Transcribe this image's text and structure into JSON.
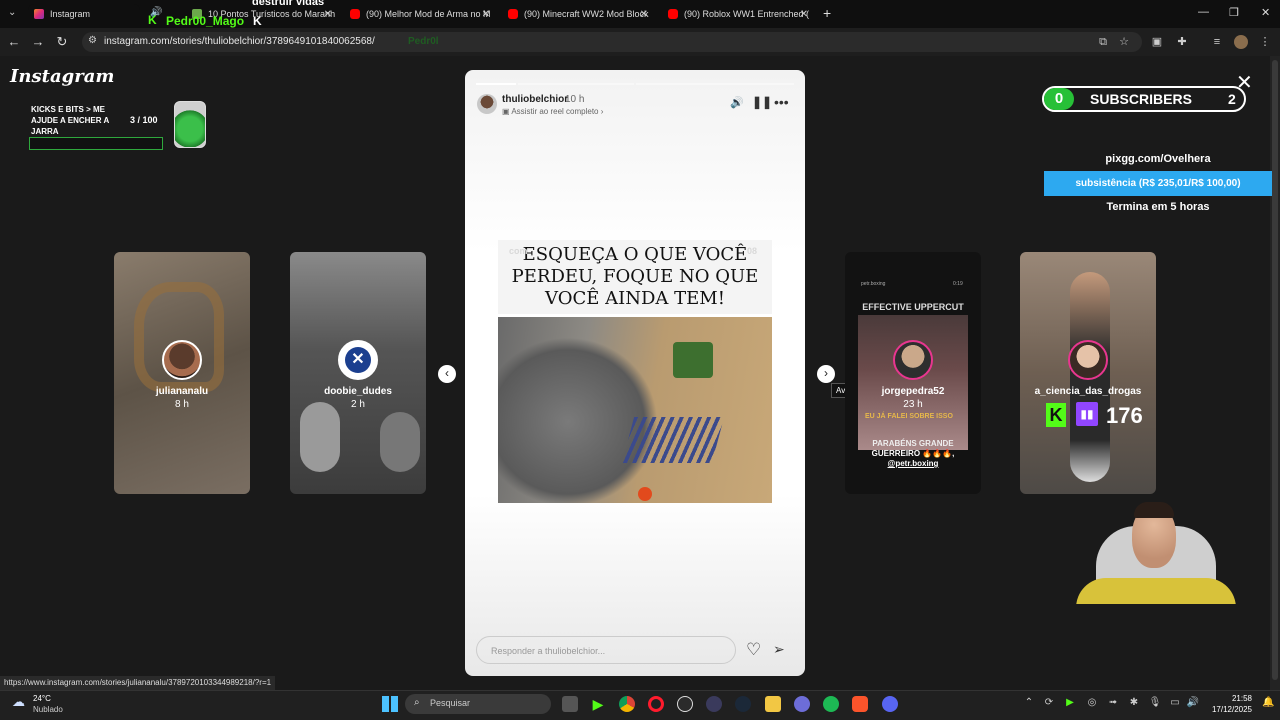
{
  "browser": {
    "tabs": [
      {
        "label": "Instagram",
        "fav_color": "#e1306c"
      },
      {
        "label": "10 Pontos Turísticos do Maranh",
        "fav_color": "#4caf50"
      },
      {
        "label": "(90) Melhor Mod de Arma no M",
        "fav_color": "#ff0000"
      },
      {
        "label": "(90) Minecraft WW2 Mod Block",
        "fav_color": "#ff0000"
      },
      {
        "label": "(90) Roblox WW1 Entrenched (",
        "fav_color": "#ff0000"
      }
    ],
    "new_tab": "+",
    "url": "instagram.com/stories/thuliobelchior/3789649101840062568/",
    "overlay_tab_name": "Pedr00_Mago",
    "overlay_tab_k": "K",
    "overlay_top_text": "destruir vidas",
    "omnibox_ghost": "Pedr0l"
  },
  "instagram": {
    "logo": "Instagram",
    "left_stories": [
      {
        "username": "juliananalu",
        "time": "8 h"
      },
      {
        "username": "doobie_dudes",
        "time": "2 h"
      }
    ],
    "right_stories": [
      {
        "username": "jorgepedra52",
        "time": "23 h",
        "top_text": "EFFECTIVE UPPERCUT",
        "header_left": "petr.boxing",
        "header_right": "0:19",
        "line1": "EU JÁ FALEI SOBRE ISSO",
        "line2": "PARABÉNS GRANDE",
        "line3": "GUERREIRO 🔥🔥🔥,",
        "line4": "@petr.boxing"
      },
      {
        "username": "a_ciencia_das_drogas",
        "time": ""
      }
    ],
    "story": {
      "username": "thuliobelchior",
      "time": "10 h",
      "reel_link": "Assistir ao reel completo",
      "quote": "ESQUEÇA O QUE VOCÊ PERDEU, FOQUE NO QUE VOCÊ AINDA TEM!",
      "quote_ghost": "com",
      "quote_ghost_right": "08",
      "reply_placeholder": "Responder a thuliobelchior..."
    },
    "tooltip": "Avançar"
  },
  "overlays": {
    "subs_left": "0",
    "subs_label": "SUBSCRIBERS",
    "subs_right": "2",
    "pix_url": "pixgg.com/Ovelhera",
    "pix_goal": "subsistência (R$ 235,01/R$ 100,00)",
    "pix_ends": "Termina em 5 horas",
    "kicks_text": "KICKS E BITS > ME AJUDE A ENCHER A JARRA",
    "kicks_count": "3   / 100",
    "kick_viewers": "176"
  },
  "status_url": "https://www.instagram.com/stories/juliananalu/3789720103344989218/?r=1",
  "taskbar": {
    "weather_temp": "24°C",
    "weather_desc": "Nublado",
    "search_placeholder": "Pesquisar",
    "time": "21:58",
    "date": "17/12/2025"
  }
}
